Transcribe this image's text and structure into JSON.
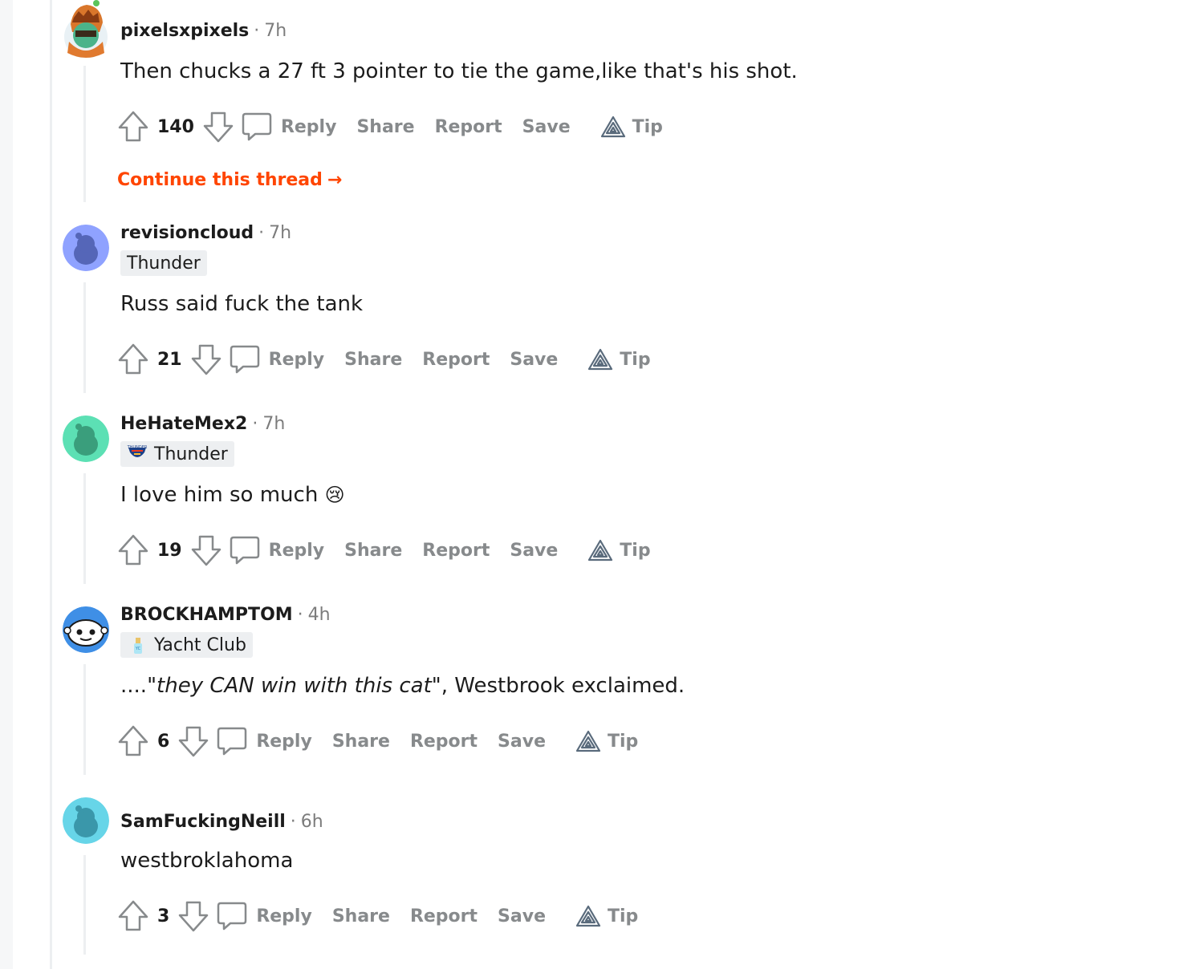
{
  "comments": [
    {
      "username": "pixelsxpixels",
      "time": "7h",
      "flair": null,
      "body": "Then chucks a 27 ft 3 pointer to tie the game,like that's his shot.",
      "score": "140",
      "actions": {
        "reply": "Reply",
        "share": "Share",
        "report": "Report",
        "save": "Save",
        "tip": "Tip"
      },
      "continue_label": "Continue this thread"
    },
    {
      "username": "revisioncloud",
      "time": "7h",
      "flair": "Thunder",
      "body": "Russ said fuck the tank",
      "score": "21",
      "actions": {
        "reply": "Reply",
        "share": "Share",
        "report": "Report",
        "save": "Save",
        "tip": "Tip"
      }
    },
    {
      "username": "HeHateMex2",
      "time": "7h",
      "flair": "Thunder",
      "body": "I love him so much",
      "emoji": "😢",
      "score": "19",
      "actions": {
        "reply": "Reply",
        "share": "Share",
        "report": "Report",
        "save": "Save",
        "tip": "Tip"
      }
    },
    {
      "username": "BROCKHAMPTOM",
      "time": "4h",
      "flair": "Yacht Club",
      "body_prefix": "....",
      "body_italic": "\"they CAN win with this cat\"",
      "body_suffix": ", Westbrook exclaimed.",
      "score": "6",
      "actions": {
        "reply": "Reply",
        "share": "Share",
        "report": "Report",
        "save": "Save",
        "tip": "Tip"
      }
    },
    {
      "username": "SamFuckingNeill",
      "time": "6h",
      "flair": null,
      "body": "westbroklahoma",
      "score": "3",
      "actions": {
        "reply": "Reply",
        "share": "Share",
        "report": "Report",
        "save": "Save",
        "tip": "Tip"
      }
    }
  ],
  "colors": {
    "accent": "#ff4500",
    "meta_gray": "#7c7c7c",
    "action_gray": "#878a8c",
    "flair_bg": "#edeff1",
    "avatar_blue": "#8fa2ff",
    "avatar_green": "#5ce0b4",
    "avatar_cyan": "#67d5e8"
  }
}
